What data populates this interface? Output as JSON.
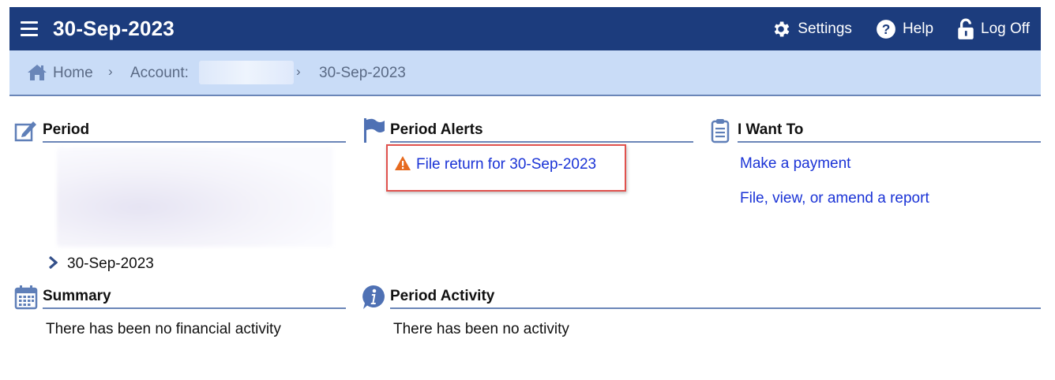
{
  "header": {
    "title": "30-Sep-2023",
    "settings_label": "Settings",
    "help_label": "Help",
    "logoff_label": "Log Off"
  },
  "breadcrumb": {
    "home": "Home",
    "account": "Account:",
    "current": "30-Sep-2023",
    "separator": "›"
  },
  "period": {
    "title": "Period",
    "item": "30-Sep-2023"
  },
  "alerts": {
    "title": "Period Alerts",
    "item": "File return for 30-Sep-2023"
  },
  "iwant": {
    "title": "I Want To",
    "links": [
      "Make a payment",
      "File, view, or amend a report"
    ]
  },
  "summary": {
    "title": "Summary",
    "text": "There has been no financial activity"
  },
  "activity": {
    "title": "Period Activity",
    "text": "There has been no activity"
  },
  "colors": {
    "header_bg": "#1c3c7d",
    "breadcrumb_bg": "#c9dcf7",
    "link": "#1a33d6",
    "alert_border": "#e0524e",
    "warning": "#e66a1f"
  }
}
